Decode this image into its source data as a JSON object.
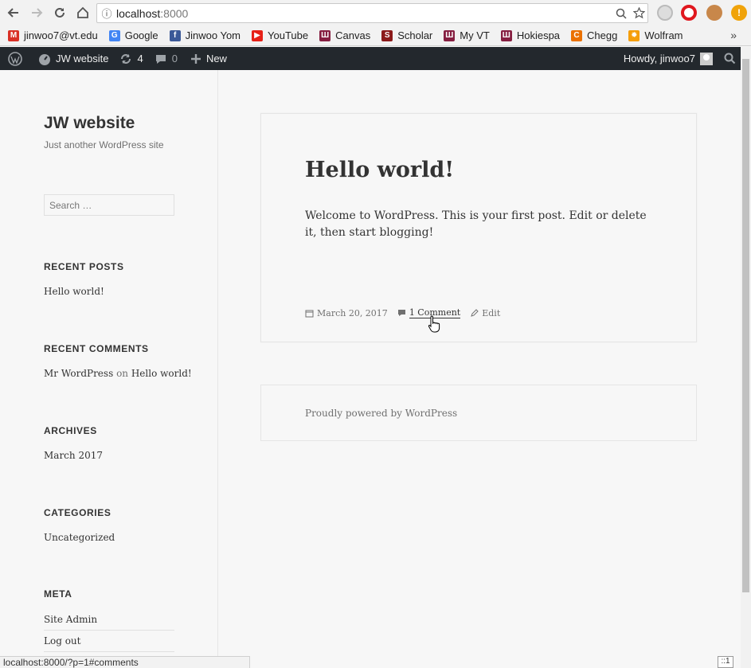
{
  "browser": {
    "url_host": "localhost",
    "url_port": ":8000",
    "bookmarks": [
      {
        "label": "jinwoo7@vt.edu",
        "icon": "gmail-icon",
        "color": "#d93025",
        "glyph": "M"
      },
      {
        "label": "Google",
        "icon": "google-icon",
        "color": "#4285f4",
        "glyph": "G"
      },
      {
        "label": "Jinwoo Yom",
        "icon": "facebook-icon",
        "color": "#3b5998",
        "glyph": "f"
      },
      {
        "label": "YouTube",
        "icon": "youtube-icon",
        "color": "#e62117",
        "glyph": "▶"
      },
      {
        "label": "Canvas",
        "icon": "vt-icon",
        "color": "#861f41",
        "glyph": "Ш"
      },
      {
        "label": "Scholar",
        "icon": "scholar-icon",
        "color": "#8b1a1a",
        "glyph": "S"
      },
      {
        "label": "My VT",
        "icon": "vt-icon",
        "color": "#861f41",
        "glyph": "Ш"
      },
      {
        "label": "Hokiespa",
        "icon": "vt-icon",
        "color": "#861f41",
        "glyph": "Ш"
      },
      {
        "label": "Chegg",
        "icon": "chegg-icon",
        "color": "#eb7100",
        "glyph": "C"
      },
      {
        "label": "Wolfram",
        "icon": "wolfram-icon",
        "color": "#f59e0b",
        "glyph": "✹"
      }
    ],
    "status_url": "localhost:8000/?p=1#comments",
    "corner_label": "::1"
  },
  "adminbar": {
    "site_name": "JW website",
    "updates_count": "4",
    "comments_count": "0",
    "new_label": "New",
    "howdy": "Howdy, jinwoo7"
  },
  "sidebar": {
    "site_title": "JW website",
    "site_description": "Just another WordPress site",
    "search_placeholder": "Search …",
    "recent_posts_title": "RECENT POSTS",
    "recent_posts": [
      "Hello world!"
    ],
    "recent_comments_title": "RECENT COMMENTS",
    "recent_comment_author": "Mr WordPress",
    "recent_comment_on": "on",
    "recent_comment_post": "Hello world!",
    "archives_title": "ARCHIVES",
    "archives": [
      "March 2017"
    ],
    "categories_title": "CATEGORIES",
    "categories": [
      "Uncategorized"
    ],
    "meta_title": "META",
    "meta_links": [
      "Site Admin",
      "Log out"
    ]
  },
  "post": {
    "title": "Hello world!",
    "body": "Welcome to WordPress. This is your first post. Edit or delete it, then start blogging!",
    "date": "March 20, 2017",
    "comments_link": "1 Comment",
    "edit_link": "Edit"
  },
  "footer": {
    "text": "Proudly powered by WordPress"
  }
}
